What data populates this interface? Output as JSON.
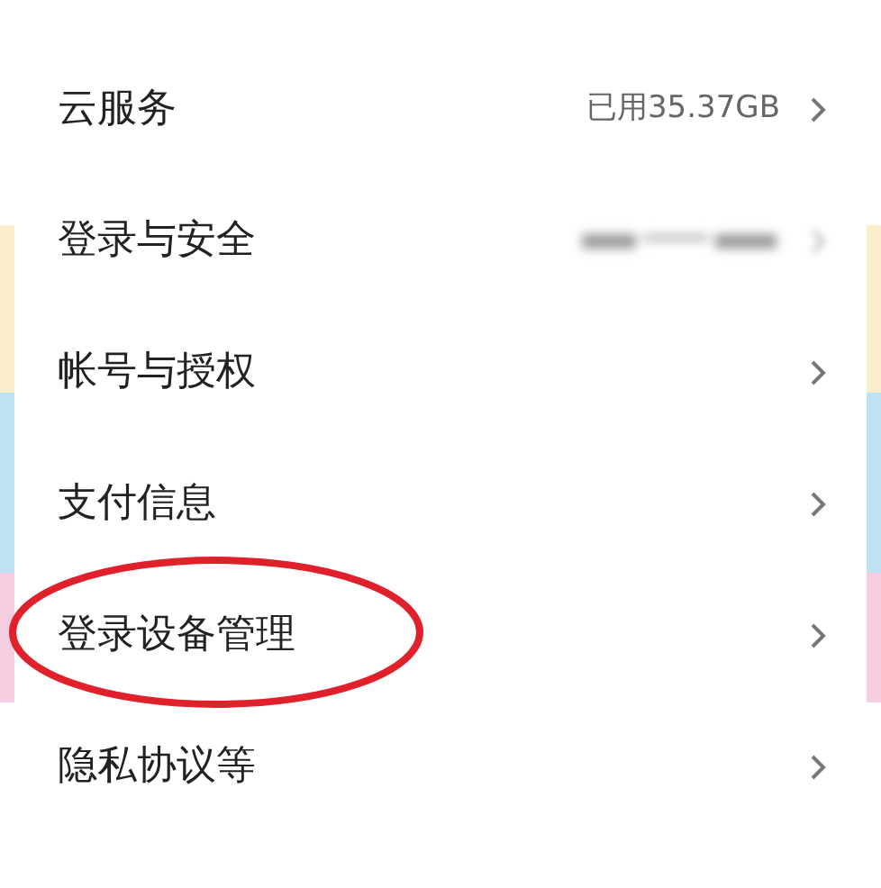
{
  "settings": [
    {
      "label": "云服务",
      "kind": "value",
      "value": "已用35.37GB",
      "circled": false
    },
    {
      "label": "登录与安全",
      "kind": "blurred",
      "circled": false
    },
    {
      "label": "帐号与授权",
      "kind": "plain",
      "circled": false
    },
    {
      "label": "支付信息",
      "kind": "plain",
      "circled": false
    },
    {
      "label": "登录设备管理",
      "kind": "plain",
      "circled": true
    },
    {
      "label": "隐私协议等",
      "kind": "plain",
      "circled": false
    }
  ]
}
